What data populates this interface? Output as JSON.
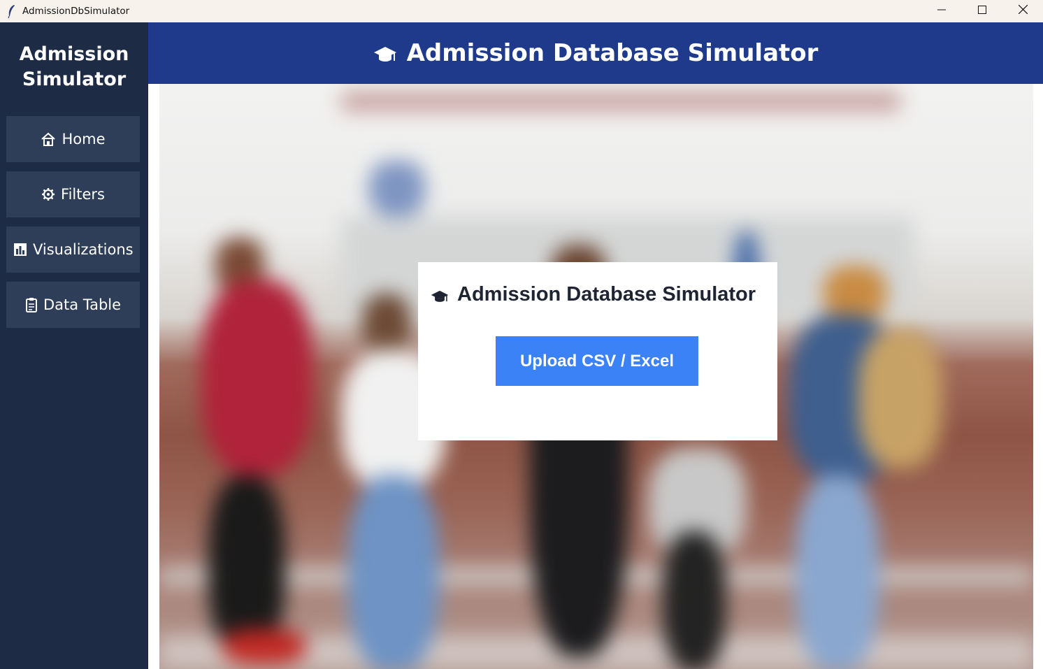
{
  "window": {
    "title": "AdmissionDbSimulator",
    "controls": [
      "minimize-icon",
      "maximize-icon",
      "close-icon"
    ]
  },
  "sidebar": {
    "title_line1": "Admission",
    "title_line2": "Simulator",
    "items": [
      {
        "label": "Home",
        "icon": "home-icon"
      },
      {
        "label": "Filters",
        "icon": "gear-icon"
      },
      {
        "label": "Visualizations",
        "icon": "bar-chart-icon"
      },
      {
        "label": "Data Table",
        "icon": "clipboard-icon"
      }
    ]
  },
  "header": {
    "title": "Admission Database Simulator",
    "icon": "graduation-cap-icon"
  },
  "card": {
    "title": "Admission Database Simulator",
    "icon": "graduation-cap-icon",
    "upload_label": "Upload CSV / Excel"
  },
  "colors": {
    "sidebar_bg": "#1e2b45",
    "nav_button_bg": "#2e3e58",
    "header_bg": "#1f3a8a",
    "upload_button_bg": "#3b82f6",
    "titlebar_bg": "#f7f3ec"
  }
}
